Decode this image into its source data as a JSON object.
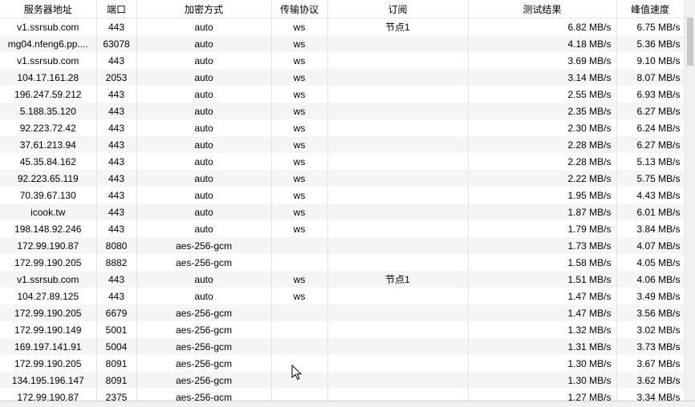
{
  "columns": [
    "服务器地址",
    "端口",
    "加密方式",
    "传输协议",
    "订阅",
    "测试结果",
    "峰值速度"
  ],
  "rows": [
    [
      "v1.ssrsub.com",
      "443",
      "auto",
      "ws",
      "节点1",
      "6.82 MB/s",
      "6.75 MB/s"
    ],
    [
      "mg04.nfeng6.pp....",
      "63078",
      "auto",
      "ws",
      "",
      "4.18 MB/s",
      "5.36 MB/s"
    ],
    [
      "v1.ssrsub.com",
      "443",
      "auto",
      "ws",
      "",
      "3.69 MB/s",
      "9.10 MB/s"
    ],
    [
      "104.17.161.28",
      "2053",
      "auto",
      "ws",
      "",
      "3.14 MB/s",
      "8.07 MB/s"
    ],
    [
      "196.247.59.212",
      "443",
      "auto",
      "ws",
      "",
      "2.55 MB/s",
      "6.93 MB/s"
    ],
    [
      "5.188.35.120",
      "443",
      "auto",
      "ws",
      "",
      "2.35 MB/s",
      "6.27 MB/s"
    ],
    [
      "92.223.72.42",
      "443",
      "auto",
      "ws",
      "",
      "2.30 MB/s",
      "6.24 MB/s"
    ],
    [
      "37.61.213.94",
      "443",
      "auto",
      "ws",
      "",
      "2.28 MB/s",
      "6.27 MB/s"
    ],
    [
      "45.35.84.162",
      "443",
      "auto",
      "ws",
      "",
      "2.28 MB/s",
      "5.13 MB/s"
    ],
    [
      "92.223.65.119",
      "443",
      "auto",
      "ws",
      "",
      "2.22 MB/s",
      "5.75 MB/s"
    ],
    [
      "70.39.67.130",
      "443",
      "auto",
      "ws",
      "",
      "1.95 MB/s",
      "4.43 MB/s"
    ],
    [
      "icook.tw",
      "443",
      "auto",
      "ws",
      "",
      "1.87 MB/s",
      "6.01 MB/s"
    ],
    [
      "198.148.92.246",
      "443",
      "auto",
      "ws",
      "",
      "1.79 MB/s",
      "3.84 MB/s"
    ],
    [
      "172.99.190.87",
      "8080",
      "aes-256-gcm",
      "",
      "",
      "1.73 MB/s",
      "4.07 MB/s"
    ],
    [
      "172.99.190.205",
      "8882",
      "aes-256-gcm",
      "",
      "",
      "1.58 MB/s",
      "4.05 MB/s"
    ],
    [
      "v1.ssrsub.com",
      "443",
      "auto",
      "ws",
      "节点1",
      "1.51 MB/s",
      "4.06 MB/s"
    ],
    [
      "104.27.89.125",
      "443",
      "auto",
      "ws",
      "",
      "1.47 MB/s",
      "3.49 MB/s"
    ],
    [
      "172.99.190.205",
      "6679",
      "aes-256-gcm",
      "",
      "",
      "1.47 MB/s",
      "3.56 MB/s"
    ],
    [
      "172.99.190.149",
      "5001",
      "aes-256-gcm",
      "",
      "",
      "1.32 MB/s",
      "3.02 MB/s"
    ],
    [
      "169.197.141.91",
      "5004",
      "aes-256-gcm",
      "",
      "",
      "1.31 MB/s",
      "3.73 MB/s"
    ],
    [
      "172.99.190.205",
      "8091",
      "aes-256-gcm",
      "",
      "",
      "1.30 MB/s",
      "3.67 MB/s"
    ],
    [
      "134.195.196.147",
      "8091",
      "aes-256-gcm",
      "",
      "",
      "1.30 MB/s",
      "3.62 MB/s"
    ],
    [
      "172.99.190.87",
      "2375",
      "aes-256-gcm",
      "",
      "",
      "1.27 MB/s",
      "3.34 MB/s"
    ]
  ]
}
